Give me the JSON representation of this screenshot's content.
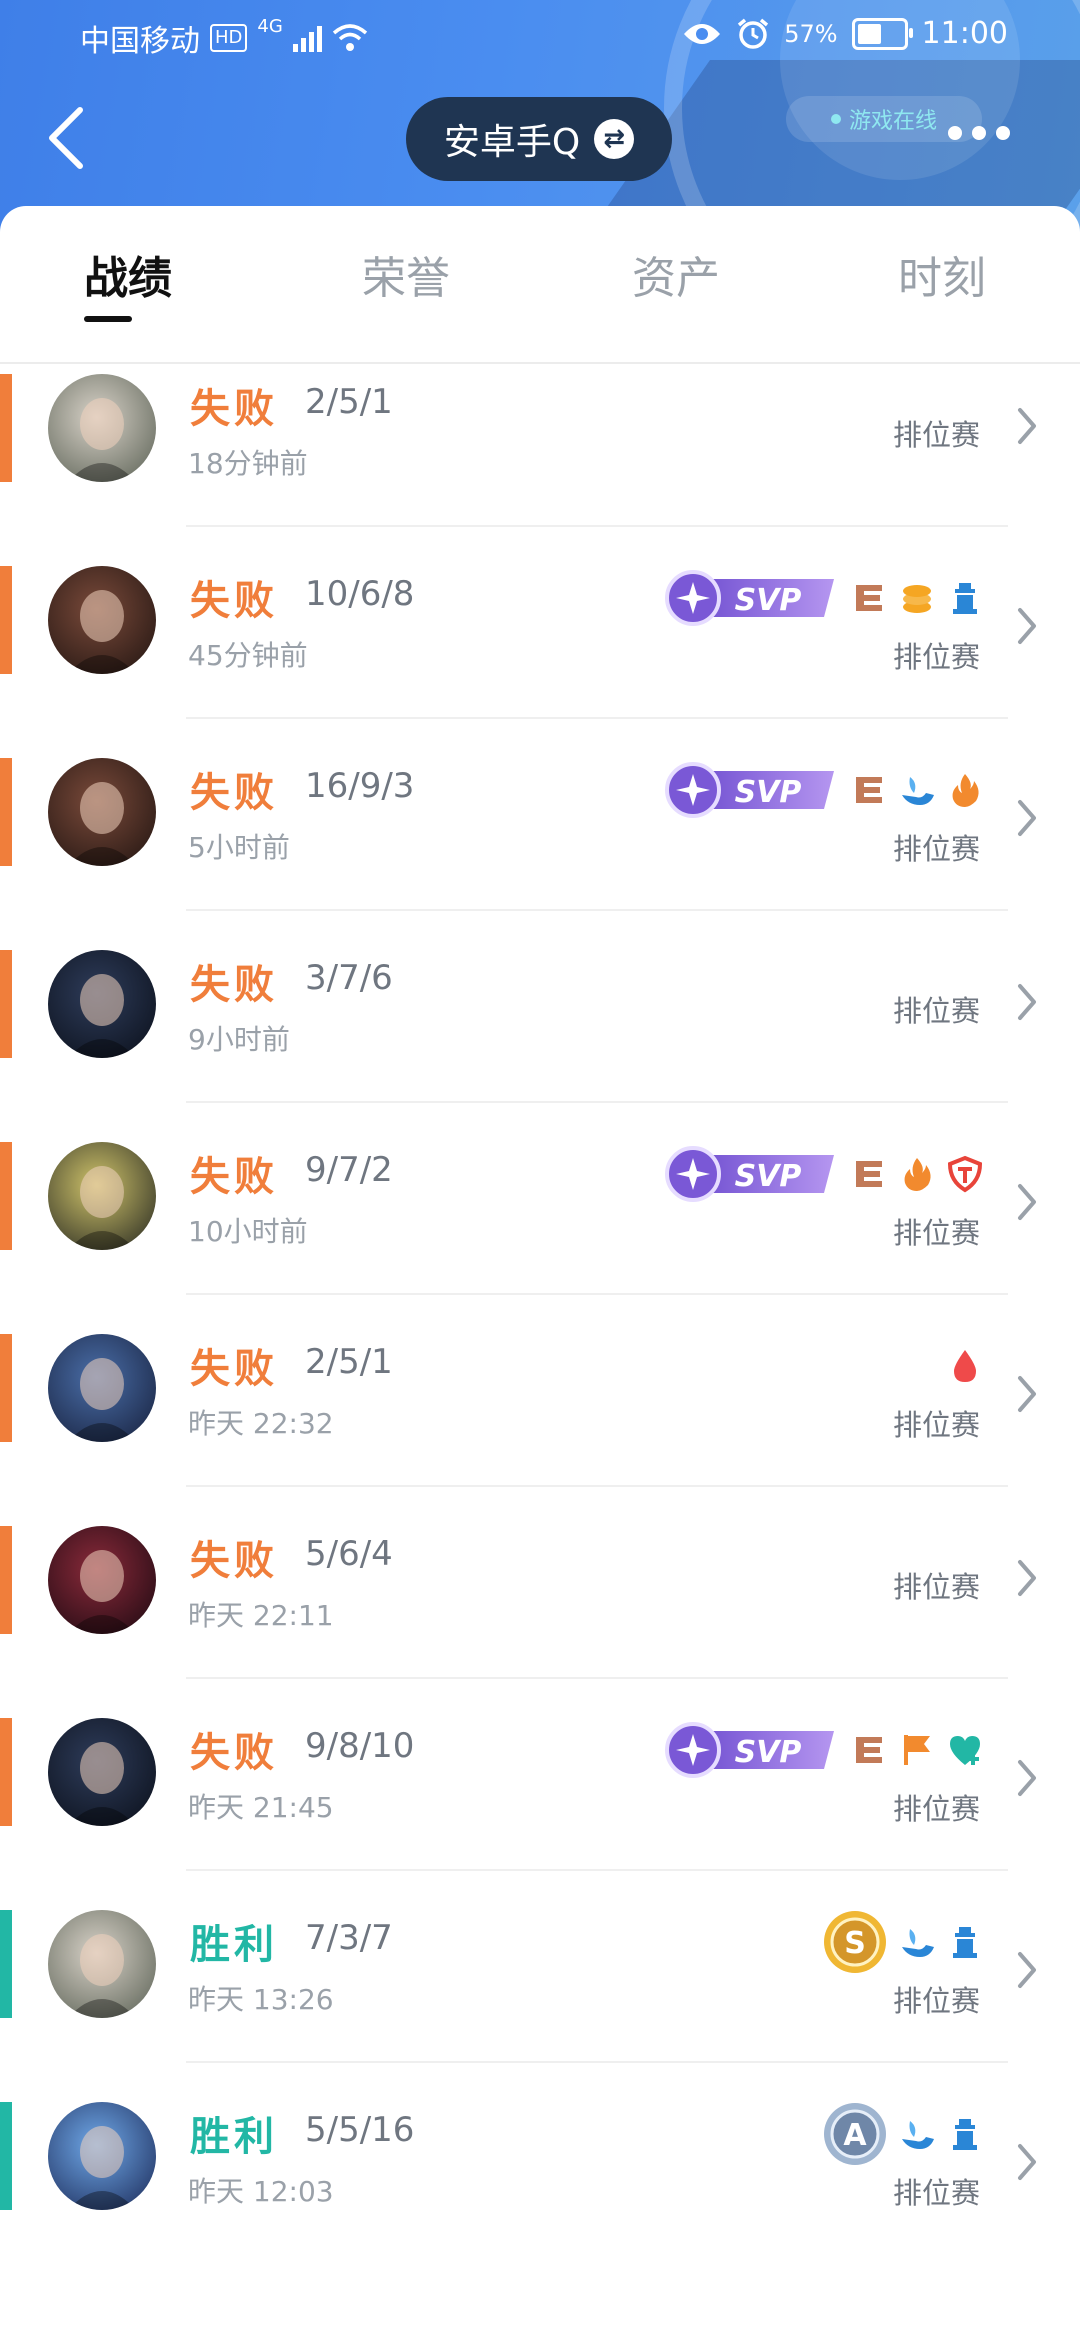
{
  "status_bar": {
    "carrier": "中国移动",
    "hd": "HD",
    "network": "4G",
    "battery": "57%",
    "battery_level": 0.57,
    "time": "11:00"
  },
  "header": {
    "account": "安卓手Q",
    "online": "游戏在线"
  },
  "tabs": [
    {
      "label": "战绩",
      "active": true
    },
    {
      "label": "荣誉",
      "active": false
    },
    {
      "label": "资产",
      "active": false
    },
    {
      "label": "时刻",
      "active": false
    }
  ],
  "colors": {
    "lose": "#f07e3b",
    "win": "#22b7a5",
    "svp": "#8a62d8",
    "header": "#4a8df0"
  },
  "matches": [
    {
      "result": "失败",
      "outcome": "lose",
      "kda": "2/5/1",
      "time": "18分钟前",
      "mode": "排位赛",
      "badges": []
    },
    {
      "result": "失败",
      "outcome": "lose",
      "kda": "10/6/8",
      "time": "45分钟前",
      "mode": "排位赛",
      "badges": [
        "svp-icon",
        "triple-kill-icon",
        "coins-icon",
        "tower-icon"
      ]
    },
    {
      "result": "失败",
      "outcome": "lose",
      "kda": "16/9/3",
      "time": "5小时前",
      "mode": "排位赛",
      "badges": [
        "svp-icon",
        "triple-kill-icon",
        "support-hand-icon",
        "fire-icon"
      ]
    },
    {
      "result": "失败",
      "outcome": "lose",
      "kda": "3/7/6",
      "time": "9小时前",
      "mode": "排位赛",
      "badges": []
    },
    {
      "result": "失败",
      "outcome": "lose",
      "kda": "9/7/2",
      "time": "10小时前",
      "mode": "排位赛",
      "badges": [
        "svp-icon",
        "triple-kill-icon",
        "fire-icon",
        "shield-damage-icon"
      ]
    },
    {
      "result": "失败",
      "outcome": "lose",
      "kda": "2/5/1",
      "time": "昨天 22:32",
      "mode": "排位赛",
      "badges": [
        "blood-drop-icon"
      ]
    },
    {
      "result": "失败",
      "outcome": "lose",
      "kda": "5/6/4",
      "time": "昨天 22:11",
      "mode": "排位赛",
      "badges": []
    },
    {
      "result": "失败",
      "outcome": "lose",
      "kda": "9/8/10",
      "time": "昨天 21:45",
      "mode": "排位赛",
      "badges": [
        "svp-icon",
        "triple-kill-icon",
        "flag-icon",
        "heal-heart-icon"
      ]
    },
    {
      "result": "胜利",
      "outcome": "win",
      "kda": "7/3/7",
      "time": "昨天 13:26",
      "mode": "排位赛",
      "badges": [
        "rank-s-medal-icon",
        "support-hand-icon",
        "tower-icon"
      ]
    },
    {
      "result": "胜利",
      "outcome": "win",
      "kda": "5/5/16",
      "time": "昨天 12:03",
      "mode": "排位赛",
      "badges": [
        "rank-a-medal-icon",
        "support-hand-icon",
        "tower-icon"
      ]
    }
  ]
}
